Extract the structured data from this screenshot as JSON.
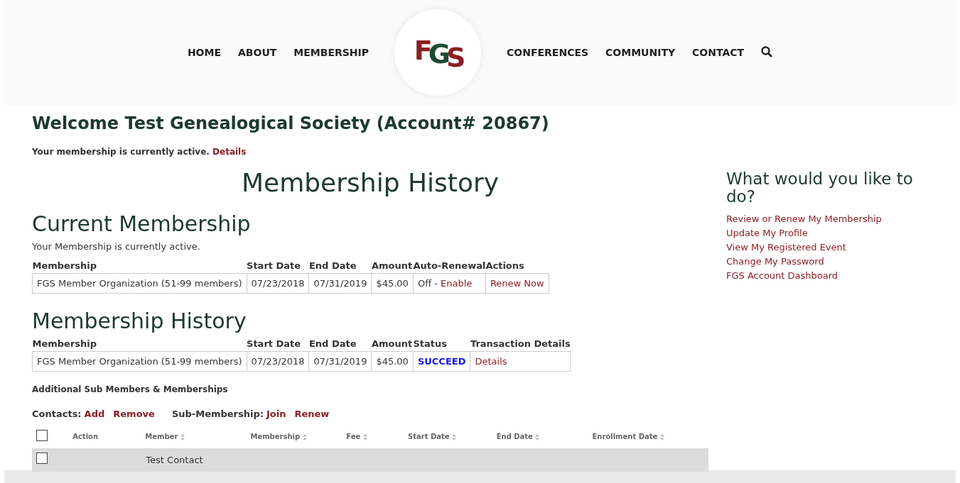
{
  "nav": {
    "left": [
      {
        "label": "HOME"
      },
      {
        "label": "ABOUT"
      },
      {
        "label": "MEMBERSHIP"
      }
    ],
    "logo": [
      {
        "letter": "F",
        "color": "#8b1e24"
      },
      {
        "letter": "G",
        "color": "#1f4a33"
      },
      {
        "letter": "S",
        "color": "#8b1e24"
      }
    ],
    "right": [
      {
        "label": "CONFERENCES"
      },
      {
        "label": "COMMUNITY"
      },
      {
        "label": "CONTACT"
      }
    ]
  },
  "welcome": "Welcome Test Genealogical Society (Account# 20867)",
  "status_line": {
    "text": "Your membership is currently active.",
    "link": "Details"
  },
  "page_title": "Membership History",
  "current": {
    "title": "Current Membership",
    "note": "Your Membership is currently active.",
    "columns": [
      "Membership",
      "Start Date",
      "End Date",
      "Amount",
      "Auto-Renewal",
      "Actions"
    ],
    "rows": [
      [
        {
          "kind": "text",
          "text": "FGS Member Organization (51-99 members)"
        },
        {
          "kind": "text",
          "text": "07/23/2018"
        },
        {
          "kind": "text",
          "text": "07/31/2019"
        },
        {
          "kind": "text",
          "text": "$45.00"
        },
        {
          "kind": "mixed",
          "text": "Off - ",
          "link": "Enable"
        },
        {
          "kind": "link",
          "text": "Renew Now"
        }
      ]
    ]
  },
  "history": {
    "title": "Membership History",
    "columns": [
      "Membership",
      "Start Date",
      "End Date",
      "Amount",
      "Status",
      "Transaction Details"
    ],
    "rows": [
      [
        {
          "kind": "text",
          "text": "FGS Member Organization (51-99 members)"
        },
        {
          "kind": "text",
          "text": "07/23/2018"
        },
        {
          "kind": "text",
          "text": "07/31/2019"
        },
        {
          "kind": "text",
          "text": "$45.00"
        },
        {
          "kind": "status",
          "text": "SUCCEED"
        },
        {
          "kind": "link",
          "text": "Details"
        }
      ]
    ]
  },
  "sub": {
    "title": "Additional Sub Members & Memberships",
    "actions": [
      {
        "kind": "label",
        "text": "Contacts:"
      },
      {
        "kind": "link",
        "text": "Add"
      },
      {
        "kind": "link",
        "text": "Remove"
      },
      {
        "kind": "label",
        "text": "Sub-Membership:"
      },
      {
        "kind": "link",
        "text": "Join"
      },
      {
        "kind": "link",
        "text": "Renew"
      }
    ],
    "header_checked": false,
    "columns": [
      {
        "label": "Action",
        "sortable": false
      },
      {
        "label": "Member",
        "sortable": true
      },
      {
        "label": "Membership",
        "sortable": true
      },
      {
        "label": "Fee",
        "sortable": true
      },
      {
        "label": "Start Date",
        "sortable": true
      },
      {
        "label": "End Date",
        "sortable": true
      },
      {
        "label": "Enrollment Date",
        "sortable": true
      }
    ],
    "rows": [
      {
        "checked": false,
        "member": "Test Contact"
      }
    ]
  },
  "sidebar": {
    "title": "What would you like to do?",
    "links": [
      "Review or Renew My Membership",
      "Update My Profile",
      "View My Registered Event",
      "Change My Password",
      "FGS Account Dashboard"
    ]
  }
}
